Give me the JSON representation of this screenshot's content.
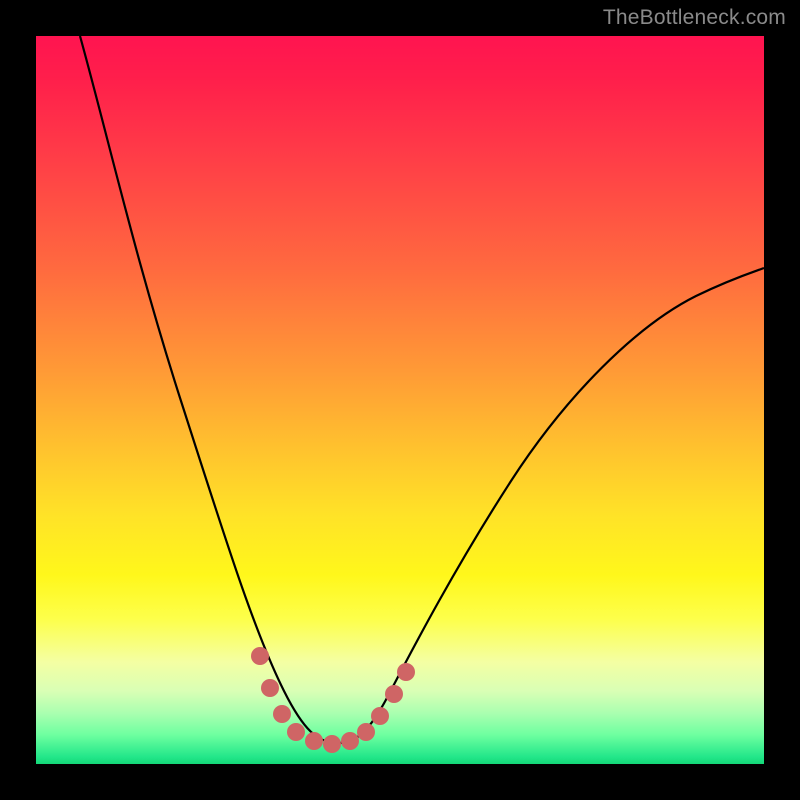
{
  "watermark": "TheBottleneck.com",
  "chart_data": {
    "type": "line",
    "title": "",
    "xlabel": "",
    "ylabel": "",
    "xlim": [
      0,
      100
    ],
    "ylim": [
      0,
      100
    ],
    "grid": false,
    "legend": false,
    "gradient_stops": [
      {
        "pos": 0,
        "color": "#ff1450"
      },
      {
        "pos": 15,
        "color": "#ff3848"
      },
      {
        "pos": 32,
        "color": "#ff6a3f"
      },
      {
        "pos": 46,
        "color": "#ff9a36"
      },
      {
        "pos": 58,
        "color": "#ffc72d"
      },
      {
        "pos": 74,
        "color": "#fff71b"
      },
      {
        "pos": 86,
        "color": "#f4ffa3"
      },
      {
        "pos": 96,
        "color": "#6effa0"
      },
      {
        "pos": 100,
        "color": "#14d878"
      }
    ],
    "series": [
      {
        "name": "bottleneck-curve",
        "color": "#000000",
        "points": [
          {
            "x": 6,
            "y": 100
          },
          {
            "x": 10,
            "y": 85
          },
          {
            "x": 15,
            "y": 68
          },
          {
            "x": 20,
            "y": 50
          },
          {
            "x": 25,
            "y": 34
          },
          {
            "x": 30,
            "y": 18
          },
          {
            "x": 33,
            "y": 10
          },
          {
            "x": 36,
            "y": 5
          },
          {
            "x": 39,
            "y": 3
          },
          {
            "x": 42,
            "y": 3
          },
          {
            "x": 45,
            "y": 4
          },
          {
            "x": 48,
            "y": 7
          },
          {
            "x": 52,
            "y": 14
          },
          {
            "x": 58,
            "y": 24
          },
          {
            "x": 65,
            "y": 35
          },
          {
            "x": 72,
            "y": 45
          },
          {
            "x": 80,
            "y": 54
          },
          {
            "x": 88,
            "y": 61
          },
          {
            "x": 96,
            "y": 66
          },
          {
            "x": 100,
            "y": 68
          }
        ]
      },
      {
        "name": "highlight-dots",
        "color": "#d86a6a",
        "points": [
          {
            "x": 30.5,
            "y": 15
          },
          {
            "x": 32,
            "y": 10.5
          },
          {
            "x": 33.5,
            "y": 7
          },
          {
            "x": 35.5,
            "y": 4.5
          },
          {
            "x": 38,
            "y": 3.2
          },
          {
            "x": 40.5,
            "y": 3
          },
          {
            "x": 43,
            "y": 3.2
          },
          {
            "x": 45,
            "y": 4.2
          },
          {
            "x": 47,
            "y": 6
          },
          {
            "x": 49,
            "y": 9
          },
          {
            "x": 50.5,
            "y": 12
          }
        ]
      }
    ]
  }
}
